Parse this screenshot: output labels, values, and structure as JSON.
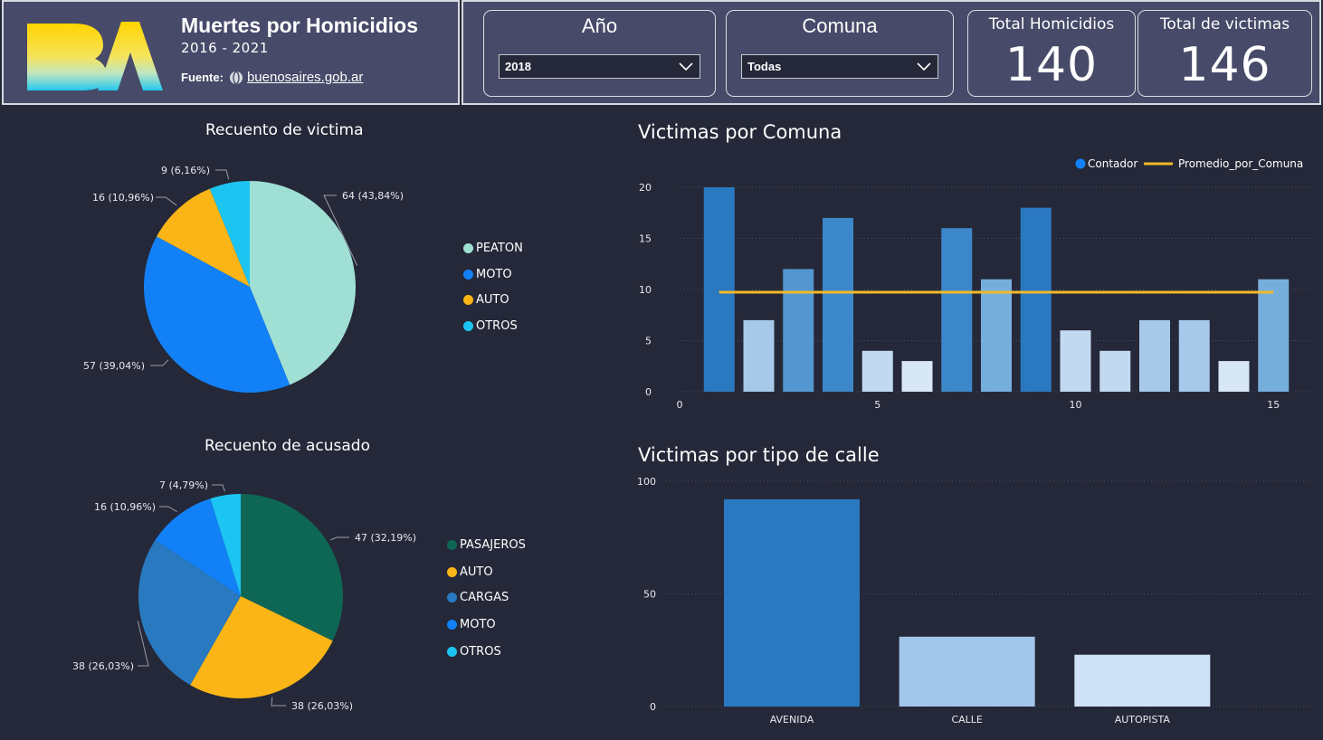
{
  "header": {
    "title": "Muertes por Homicidios",
    "years": "2016 - 2021",
    "source_label": "Fuente:",
    "source_link": "buenosaires.gob.ar"
  },
  "filters": {
    "year": {
      "title": "Año",
      "value": "2018"
    },
    "comuna": {
      "title": "Comuna",
      "value": "Todas"
    }
  },
  "kpis": {
    "homicidios": {
      "title": "Total Homicidios",
      "value": "140"
    },
    "victimas": {
      "title": "Total de victimas",
      "value": "146"
    }
  },
  "icons": {
    "logo": "ba-logo",
    "globe": "globe-icon",
    "dropdown": "chevron-down-icon"
  },
  "colors": {
    "background": "#252838",
    "header": "#474a68",
    "mint": "#a0e0d4",
    "blue": "#1281f7",
    "amber": "#fbb516",
    "cyan": "#1cc4f2",
    "dark_green": "#0e6655",
    "steel_blue": "#2879c0",
    "line": "#f2b92a"
  },
  "chart_data": [
    {
      "type": "pie",
      "title": "Recuento de victima",
      "categories": [
        "PEATON",
        "MOTO",
        "AUTO",
        "OTROS"
      ],
      "values": [
        64,
        57,
        16,
        9
      ],
      "labels": [
        "64 (43,84%)",
        "57 (39,04%)",
        "16 (10,96%)",
        "9 (6,16%)"
      ],
      "colors": [
        "#a0e0d4",
        "#1281f7",
        "#fbb516",
        "#1cc4f2"
      ],
      "legend": "right"
    },
    {
      "type": "pie",
      "title": "Recuento de acusado",
      "categories": [
        "PASAJEROS",
        "AUTO",
        "CARGAS",
        "MOTO",
        "OTROS"
      ],
      "values": [
        47,
        38,
        38,
        16,
        7
      ],
      "labels": [
        "47 (32,19%)",
        "38 (26,03%)",
        "38 (26,03%)",
        "16 (10,96%)",
        "7 (4,79%)"
      ],
      "colors": [
        "#0e6655",
        "#fbb516",
        "#2879c0",
        "#1281f7",
        "#1cc4f2"
      ],
      "legend": "right"
    },
    {
      "type": "bar",
      "title": "Victimas por Comuna",
      "series": [
        {
          "name": "Contador",
          "x": [
            1,
            2,
            3,
            4,
            5,
            6,
            7,
            8,
            9,
            10,
            11,
            12,
            13,
            14,
            15
          ],
          "values": [
            20,
            7,
            12,
            17,
            4,
            3,
            16,
            11,
            18,
            6,
            4,
            7,
            7,
            3,
            11
          ]
        },
        {
          "name": "Promedio_por_Comuna",
          "type": "line",
          "x": [
            1,
            15
          ],
          "values": [
            9.73,
            9.73
          ]
        }
      ],
      "xticks": [
        0,
        5,
        10,
        15
      ],
      "yticks": [
        0,
        5,
        10,
        15,
        20
      ],
      "xlim": [
        0,
        16
      ],
      "ylim": [
        0,
        20
      ],
      "grid": true,
      "legend": "top-right"
    },
    {
      "type": "bar",
      "title": "Victimas por tipo de calle",
      "categories": [
        "AVENIDA",
        "CALLE",
        "AUTOPISTA"
      ],
      "values": [
        92,
        31,
        23
      ],
      "yticks": [
        0,
        50,
        100
      ],
      "ylim": [
        0,
        100
      ],
      "grid": true,
      "colors": [
        "#2879c0",
        "#a2c6e9",
        "#cfe2f5"
      ]
    }
  ]
}
